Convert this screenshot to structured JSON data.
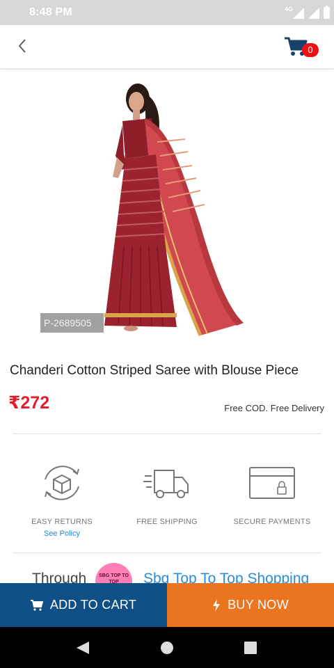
{
  "status_bar": {
    "time": "8:48 PM",
    "network": "4G"
  },
  "header": {
    "back_icon": "chevron-left-icon",
    "cart_icon": "cart-icon",
    "cart_count": "0"
  },
  "product": {
    "image_label": "saree-product-image",
    "product_id": "P-2689505",
    "title": "Chanderi Cotton Striped Saree with Blouse Piece",
    "price": "₹272",
    "delivery_note": "Free COD. Free Delivery"
  },
  "features": [
    {
      "icon": "box-returns-icon",
      "label": "EASY RETURNS",
      "link": "See Policy"
    },
    {
      "icon": "delivery-truck-icon",
      "label": "FREE SHIPPING"
    },
    {
      "icon": "card-lock-icon",
      "label": "SECURE PAYMENTS"
    }
  ],
  "promo": {
    "text": "Through",
    "badge": "SBG TOP TO TOP",
    "link": "Sbg Top To Top Shopping"
  },
  "actions": {
    "add_to_cart": "ADD TO CART",
    "buy_now": "BUY NOW"
  },
  "colors": {
    "price": "#e0202e",
    "add_to_cart_bg": "#0e4f86",
    "buy_now_bg": "#ea7420",
    "link": "#1e88e5",
    "badge": "#ee1111"
  }
}
